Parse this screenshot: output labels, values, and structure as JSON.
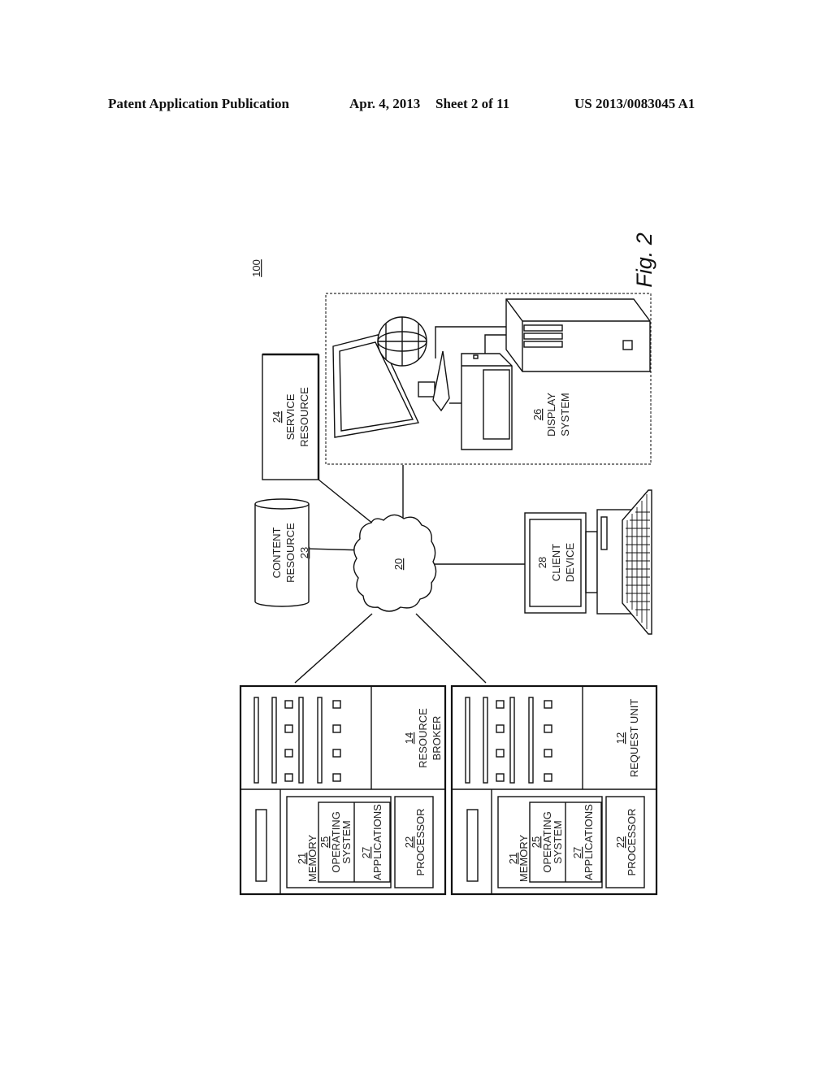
{
  "header": {
    "publication": "Patent Application Publication",
    "date": "Apr. 4, 2013",
    "sheet": "Sheet 2 of 11",
    "number": "US 2013/0083045 A1"
  },
  "figure": {
    "label": "Fig. 2",
    "system_ref": "100",
    "network": {
      "ref": "20"
    },
    "content_resource": {
      "name": "CONTENT RESOURCE",
      "line1": "CONTENT",
      "line2": "RESOURCE",
      "ref": "23"
    },
    "service_resource": {
      "ref": "24",
      "line1": "SERVICE",
      "line2": "RESOURCE"
    },
    "display_system": {
      "ref": "26",
      "line1": "DISPLAY",
      "line2": "SYSTEM"
    },
    "client_device": {
      "ref": "28",
      "line1": "CLIENT",
      "line2": "DEVICE"
    },
    "resource_broker": {
      "ref": "14",
      "line1": "RESOURCE",
      "line2": "BROKER",
      "memory": {
        "ref": "21",
        "label": "MEMORY"
      },
      "os": {
        "ref": "25",
        "line1": "OPERATING",
        "line2": "SYSTEM"
      },
      "apps": {
        "ref": "27",
        "label": "APPLICATIONS"
      },
      "processor": {
        "ref": "22",
        "label": "PROCESSOR"
      }
    },
    "request_unit": {
      "ref": "12",
      "label": "REQUEST UNIT",
      "memory": {
        "ref": "21",
        "label": "MEMORY"
      },
      "os": {
        "ref": "25",
        "line1": "OPERATING",
        "line2": "SYSTEM"
      },
      "apps": {
        "ref": "27",
        "label": "APPLICATIONS"
      },
      "processor": {
        "ref": "22",
        "label": "PROCESSOR"
      }
    }
  }
}
